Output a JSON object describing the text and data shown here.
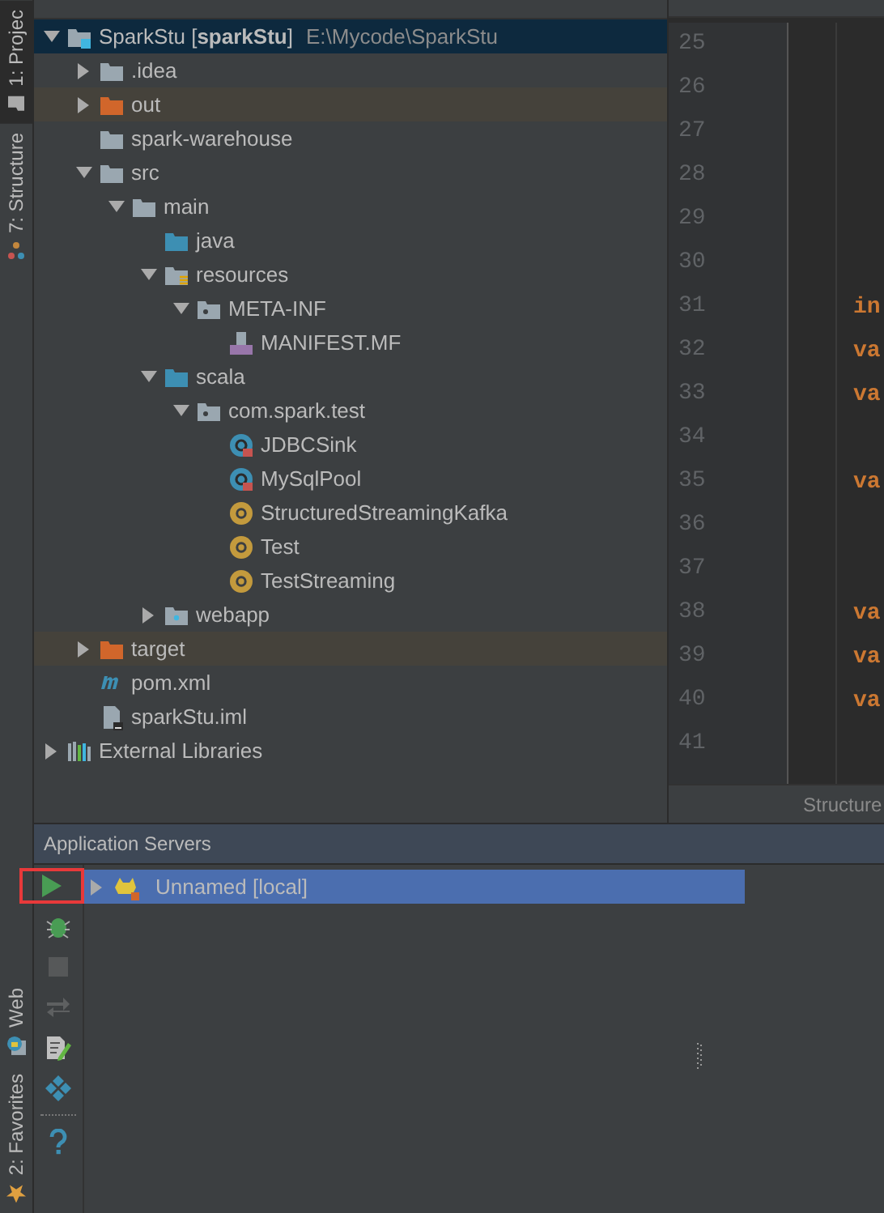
{
  "sidebar_tabs_top": [
    {
      "label": "1: Projec",
      "selected": true,
      "kind": "project"
    },
    {
      "label": "7: Structure",
      "selected": false,
      "kind": "structure"
    }
  ],
  "sidebar_tabs_bottom": [
    {
      "label": "Web",
      "selected": false,
      "kind": "web"
    },
    {
      "label": "2: Favorites",
      "selected": false,
      "kind": "favorites"
    }
  ],
  "project_tree": [
    {
      "label": "SparkStu [**sparkStu**]",
      "path": "E:\\Mycode\\SparkStu",
      "kind": "module",
      "expanded": true,
      "selected": true,
      "children": [
        {
          "label": ".idea",
          "kind": "folder",
          "expanded": false,
          "selected": false
        },
        {
          "label": "out",
          "kind": "excluded",
          "expanded": false,
          "selected": false
        },
        {
          "label": "spark-warehouse",
          "kind": "folder",
          "selected": false
        },
        {
          "label": "src",
          "kind": "folder",
          "expanded": true,
          "selected": false,
          "children": [
            {
              "label": "main",
              "kind": "folder",
              "expanded": true,
              "selected": false,
              "children": [
                {
                  "label": "java",
                  "kind": "source",
                  "selected": false
                },
                {
                  "label": "resources",
                  "kind": "resources",
                  "expanded": true,
                  "selected": false,
                  "children": [
                    {
                      "label": "META-INF",
                      "kind": "package",
                      "expanded": true,
                      "selected": false,
                      "children": [
                        {
                          "label": "MANIFEST.MF",
                          "kind": "manifest",
                          "selected": false
                        }
                      ]
                    }
                  ]
                },
                {
                  "label": "scala",
                  "kind": "source",
                  "expanded": true,
                  "selected": false,
                  "children": [
                    {
                      "label": "com.spark.test",
                      "kind": "package",
                      "expanded": true,
                      "selected": false,
                      "children": [
                        {
                          "label": "JDBCSink",
                          "kind": "class",
                          "selected": false
                        },
                        {
                          "label": "MySqlPool",
                          "kind": "class",
                          "selected": false
                        },
                        {
                          "label": "StructuredStreamingKafka",
                          "kind": "object",
                          "selected": false
                        },
                        {
                          "label": "Test",
                          "kind": "object",
                          "selected": false
                        },
                        {
                          "label": "TestStreaming",
                          "kind": "object",
                          "selected": false
                        }
                      ]
                    }
                  ]
                },
                {
                  "label": "webapp",
                  "kind": "web",
                  "expanded": false,
                  "selected": false
                }
              ]
            }
          ]
        },
        {
          "label": "target",
          "kind": "excluded",
          "expanded": false,
          "selected": false
        },
        {
          "label": "pom.xml",
          "kind": "maven",
          "selected": false
        },
        {
          "label": "sparkStu.iml",
          "kind": "iml",
          "selected": false
        }
      ]
    },
    {
      "label": "External Libraries",
      "kind": "libraries",
      "expanded": false,
      "selected": false
    }
  ],
  "editor": {
    "lines": [
      {
        "number": "25"
      },
      {
        "number": "26"
      },
      {
        "number": "27"
      },
      {
        "number": "28"
      },
      {
        "number": "29"
      },
      {
        "number": "30"
      },
      {
        "number": "31",
        "code": "in"
      },
      {
        "number": "32",
        "code": "va"
      },
      {
        "number": "33",
        "code": "va"
      },
      {
        "number": "34"
      },
      {
        "number": "35",
        "code": "va"
      },
      {
        "number": "36"
      },
      {
        "number": "37"
      },
      {
        "number": "38",
        "code": "va"
      },
      {
        "number": "39",
        "code": "va"
      },
      {
        "number": "40",
        "code": "va"
      },
      {
        "number": "41"
      }
    ],
    "structure_hint": "Structure"
  },
  "app_servers": {
    "title": "Application Servers",
    "toolbar": [
      {
        "kind": "run",
        "highlighted": true,
        "disabled": false
      },
      {
        "kind": "debug",
        "highlighted": false,
        "disabled": false
      },
      {
        "kind": "stop",
        "highlighted": false,
        "disabled": true
      },
      {
        "kind": "deploy",
        "highlighted": false,
        "disabled": true
      },
      {
        "kind": "edit",
        "highlighted": false,
        "disabled": false
      },
      {
        "kind": "artifacts",
        "highlighted": false,
        "disabled": false
      },
      {
        "kind": "separator"
      },
      {
        "kind": "help",
        "highlighted": false,
        "disabled": false
      }
    ],
    "servers": [
      {
        "label": "Unnamed [local]",
        "selected": true,
        "expanded": false
      }
    ]
  }
}
